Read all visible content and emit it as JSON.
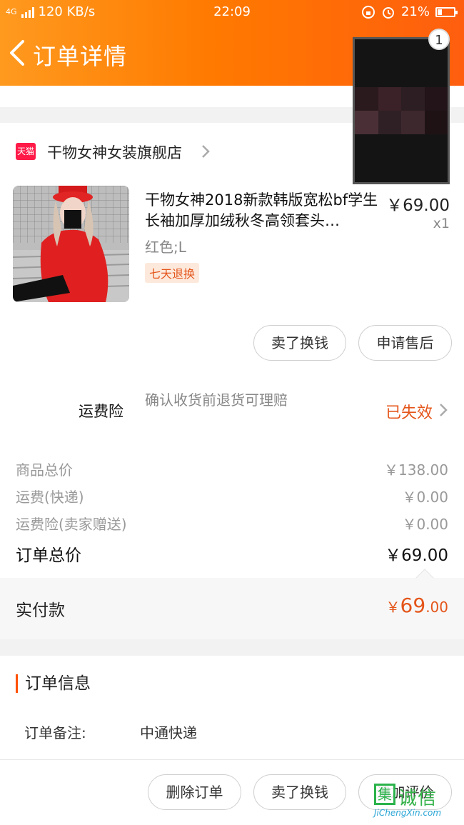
{
  "status_bar": {
    "network": "4G",
    "speed": "120 KB/s",
    "time": "22:09",
    "battery": "21%"
  },
  "nav": {
    "title": "订单详情"
  },
  "overlay": {
    "badge": "1"
  },
  "store": {
    "badge": "天猫",
    "name": "干物女神女装旗舰店"
  },
  "product": {
    "title": "干物女神2018新款韩版宽松bf学生长袖加厚加绒秋冬高领套头…",
    "sku": "红色;L",
    "tag": "七天退换",
    "price": "￥69.00",
    "quantity": "x1"
  },
  "product_actions": {
    "sell": "卖了换钱",
    "after_sale": "申请售后"
  },
  "shipping_insurance": {
    "label": "运费险",
    "description": "确认收货前退货可理赔",
    "status": "已失效"
  },
  "price_breakdown": {
    "items": [
      {
        "label": "商品总价",
        "value": "￥138.00"
      },
      {
        "label": "运费(快递)",
        "value": "￥0.00"
      },
      {
        "label": "运费险(卖家赠送)",
        "value": "￥0.00"
      }
    ],
    "total_label": "订单总价",
    "total_value": "￥69.00"
  },
  "payment": {
    "label": "实付款",
    "currency": "￥",
    "integer": "69",
    "decimal": ".00"
  },
  "order_info": {
    "title": "订单信息",
    "note_label": "订单备注:",
    "note_value": "中通快递"
  },
  "bottom_actions": {
    "delete": "删除订单",
    "sell": "卖了换钱",
    "add_review": "追加评价"
  },
  "watermark": {
    "mark": "集",
    "text": "诚信",
    "url": "JiChengXin.com"
  },
  "colors": {
    "accent": "#ff5000",
    "price_highlight": "#e4551a",
    "tmall_red": "#ff1a48"
  }
}
